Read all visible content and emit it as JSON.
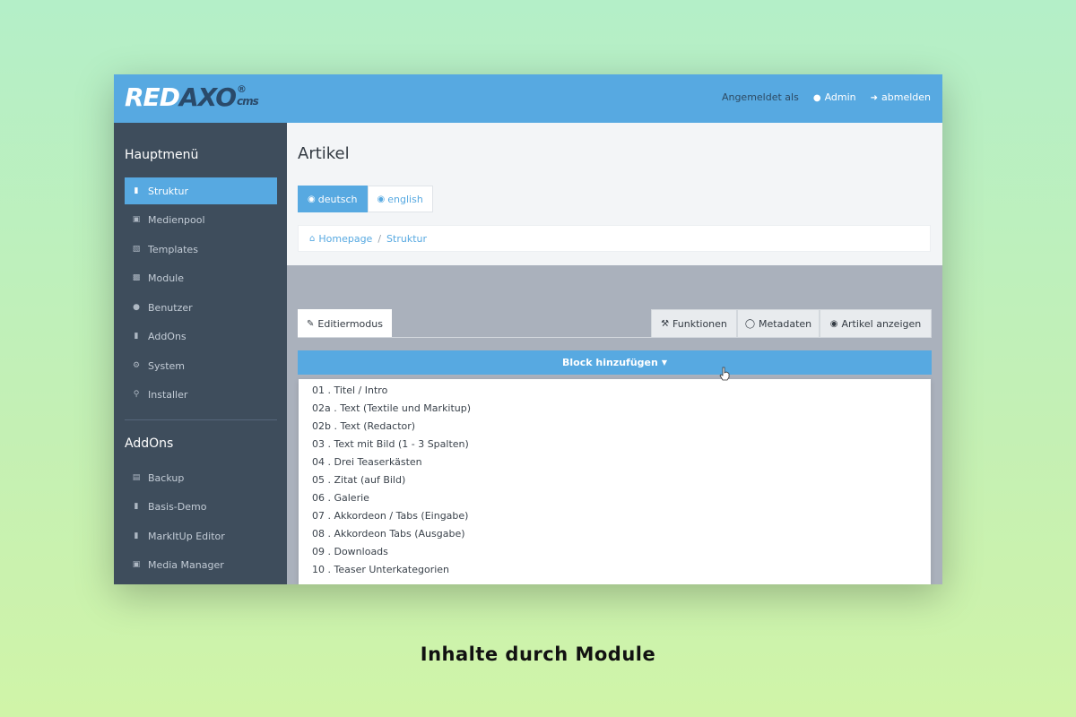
{
  "header": {
    "logo_red": "RED",
    "logo_axo": "AXO",
    "logo_reg": "®",
    "logo_cms": "cms",
    "logged_in_as": "Angemeldet als",
    "user": "Admin",
    "logout": "abmelden"
  },
  "sidebar": {
    "main_heading": "Hauptmenü",
    "main_items": [
      {
        "label": "Struktur",
        "icon": "folder-open-icon"
      },
      {
        "label": "Medienpool",
        "icon": "image-icon"
      },
      {
        "label": "Templates",
        "icon": "keyboard-icon"
      },
      {
        "label": "Module",
        "icon": "database-icon"
      },
      {
        "label": "Benutzer",
        "icon": "user-icon"
      },
      {
        "label": "AddOns",
        "icon": "bookmark-icon"
      },
      {
        "label": "System",
        "icon": "gears-icon"
      },
      {
        "label": "Installer",
        "icon": "key-icon"
      }
    ],
    "addons_heading": "AddOns",
    "addon_items": [
      {
        "label": "Backup",
        "icon": "hdd-icon"
      },
      {
        "label": "Basis-Demo",
        "icon": "bookmark-icon"
      },
      {
        "label": "MarkItUp Editor",
        "icon": "bookmark-icon"
      },
      {
        "label": "Media Manager",
        "icon": "image-icon"
      }
    ]
  },
  "main": {
    "title": "Artikel",
    "languages": [
      "deutsch",
      "english"
    ],
    "breadcrumb": [
      "Homepage",
      "Struktur"
    ],
    "tabs": {
      "edit": "Editiermodus",
      "functions": "Funktionen",
      "metadata": "Metadaten",
      "show_article": "Artikel anzeigen"
    },
    "add_block": "Block hinzufügen",
    "modules": [
      "01 . Titel / Intro",
      "02a . Text (Textile und Markitup)",
      "02b . Text (Redactor)",
      "03 . Text mit Bild (1 - 3 Spalten)",
      "04 . Drei Teaserkästen",
      "05 . Zitat (auf Bild)",
      "06 . Galerie",
      "07 . Akkordeon / Tabs (Eingabe)",
      "08 . Akkordeon Tabs (Ausgabe)",
      "09 . Downloads",
      "10 . Teaser Unterkategorien"
    ]
  },
  "caption": "Inhalte durch Module",
  "colors": {
    "accent": "#57a9e1",
    "sidebar": "#3e4d5c",
    "background_top": "#b4efc8",
    "background_bottom": "#d0f4a8"
  }
}
